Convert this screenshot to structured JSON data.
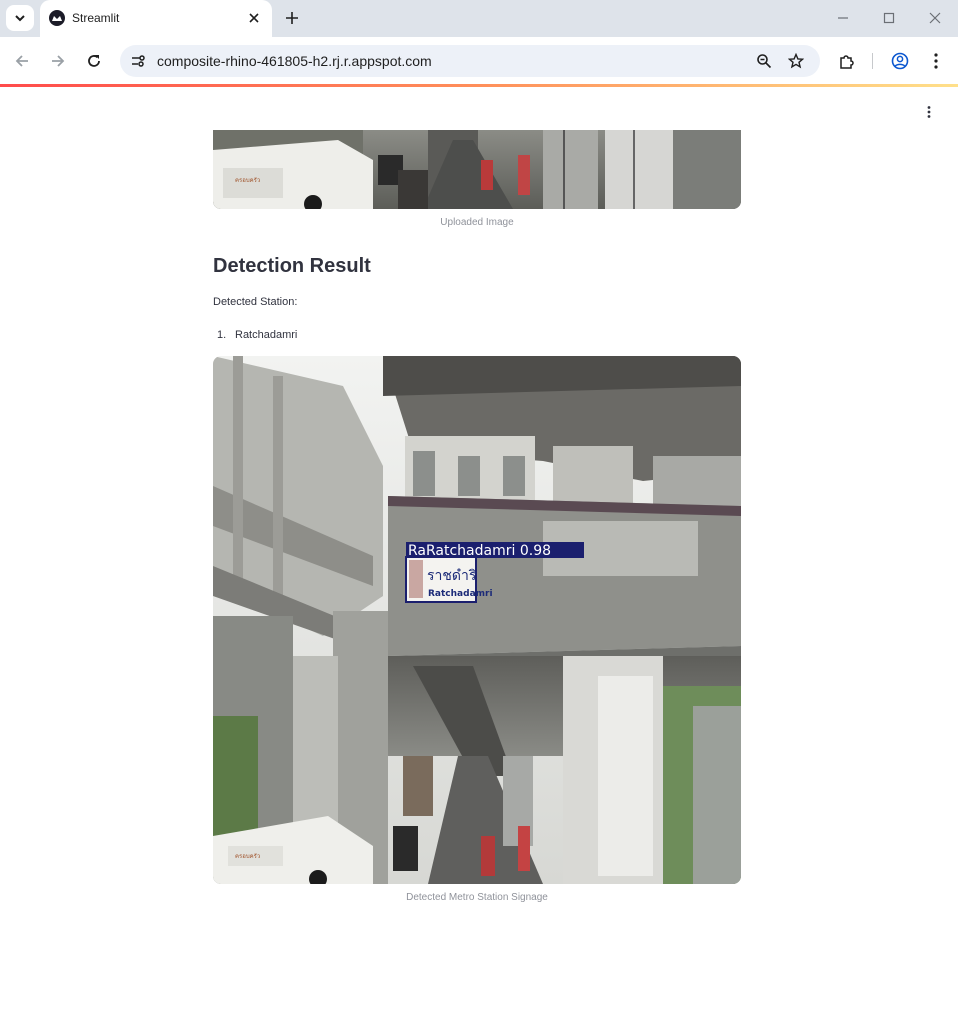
{
  "browser": {
    "tab_title": "Streamlit",
    "url": "composite-rhino-461805-h2.rj.r.appspot.com",
    "icons": [
      "tab-search-icon",
      "streamlit-favicon",
      "close-icon",
      "plus-icon",
      "minimize-icon",
      "maximize-icon",
      "close-window-icon",
      "back-icon",
      "forward-icon",
      "reload-icon",
      "site-info-icon",
      "zoom-icon",
      "star-icon",
      "extensions-icon",
      "profile-icon",
      "menu-icon"
    ]
  },
  "app": {
    "uploaded_caption": "Uploaded Image",
    "section_title": "Detection Result",
    "detected_label": "Detected Station:",
    "stations": [
      {
        "number": "1.",
        "name": "Ratchadamri"
      }
    ],
    "detection": {
      "box_label": "RaRatchadamri 0.98",
      "sign_thai": "ราชดำริ",
      "sign_en": "Ratchadamri"
    },
    "result_caption": "Detected Metro Station Signage"
  },
  "colors": {
    "tabbar": "#dee3ea",
    "omnibox": "#edf1f8",
    "text": "#31333f",
    "caption": "#8f929a",
    "detection_box": "#1b1f6e"
  }
}
